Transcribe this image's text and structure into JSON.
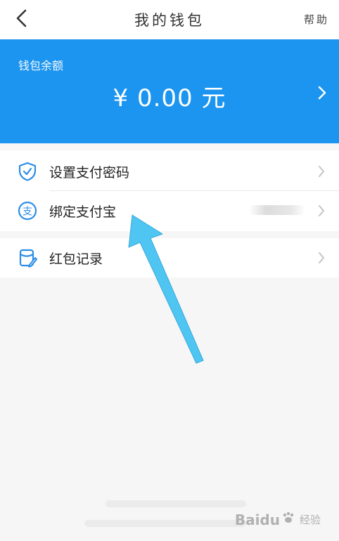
{
  "header": {
    "back_icon": "chevron-left-icon",
    "title": "我的钱包",
    "help_label": "帮助"
  },
  "balance": {
    "label": "钱包余额",
    "amount": "¥ 0.00 元",
    "chevron_icon": "chevron-right-icon",
    "background_color": "#1c95f0"
  },
  "menu": {
    "items": [
      {
        "icon": "shield-check-icon",
        "label": "设置支付密码"
      },
      {
        "icon": "alipay-icon",
        "label": "绑定支付宝"
      },
      {
        "icon": "red-envelope-record-icon",
        "label": "红包记录"
      }
    ]
  },
  "annotation": {
    "arrow_color": "#4fc6f2"
  },
  "watermark": {
    "brand": "Baidu",
    "sub": "经验"
  }
}
